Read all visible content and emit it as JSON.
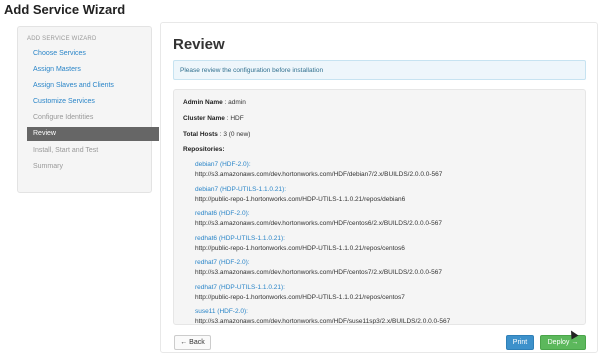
{
  "page": {
    "title": "Add Service Wizard"
  },
  "sidebar": {
    "header": "ADD SERVICE WIZARD",
    "items": [
      {
        "label": "Choose Services",
        "state": "link"
      },
      {
        "label": "Assign Masters",
        "state": "link"
      },
      {
        "label": "Assign Slaves and Clients",
        "state": "link"
      },
      {
        "label": "Customize Services",
        "state": "link"
      },
      {
        "label": "Configure Identities",
        "state": "muted"
      },
      {
        "label": "Review",
        "state": "active"
      },
      {
        "label": "Install, Start and Test",
        "state": "muted"
      },
      {
        "label": "Summary",
        "state": "muted"
      }
    ]
  },
  "main": {
    "title": "Review",
    "alert": "Please review the configuration before installation",
    "admin_label": "Admin Name",
    "admin_value": " : admin",
    "cluster_label": "Cluster Name",
    "cluster_value": " : HDF",
    "hosts_label": "Total Hosts",
    "hosts_value": " : 3 (0 new)",
    "repos_label": "Repositories:",
    "repos": [
      {
        "name": "debian7 (HDF-2.0):",
        "url": "http://s3.amazonaws.com/dev.hortonworks.com/HDF/debian7/2.x/BUILDS/2.0.0.0-567"
      },
      {
        "name": "debian7 (HDP-UTILS-1.1.0.21):",
        "url": "http://public-repo-1.hortonworks.com/HDP-UTILS-1.1.0.21/repos/debian6"
      },
      {
        "name": "redhat6 (HDF-2.0):",
        "url": "http://s3.amazonaws.com/dev.hortonworks.com/HDF/centos6/2.x/BUILDS/2.0.0.0-567"
      },
      {
        "name": "redhat6 (HDP-UTILS-1.1.0.21):",
        "url": "http://public-repo-1.hortonworks.com/HDP-UTILS-1.1.0.21/repos/centos6"
      },
      {
        "name": "redhat7 (HDF-2.0):",
        "url": "http://s3.amazonaws.com/dev.hortonworks.com/HDF/centos7/2.x/BUILDS/2.0.0.0-567"
      },
      {
        "name": "redhat7 (HDP-UTILS-1.1.0.21):",
        "url": "http://public-repo-1.hortonworks.com/HDP-UTILS-1.1.0.21/repos/centos7"
      },
      {
        "name": "suse11 (HDF-2.0):",
        "url": "http://s3.amazonaws.com/dev.hortonworks.com/HDF/suse11sp3/2.x/BUILDS/2.0.0.0-567"
      }
    ]
  },
  "footer": {
    "back_label": "← Back",
    "print_label": "Print",
    "deploy_label": "Deploy →"
  },
  "colors": {
    "link": "#2a85c8",
    "primary": "#3d91cb",
    "success": "#5cb85c",
    "active_nav": "#666666"
  }
}
